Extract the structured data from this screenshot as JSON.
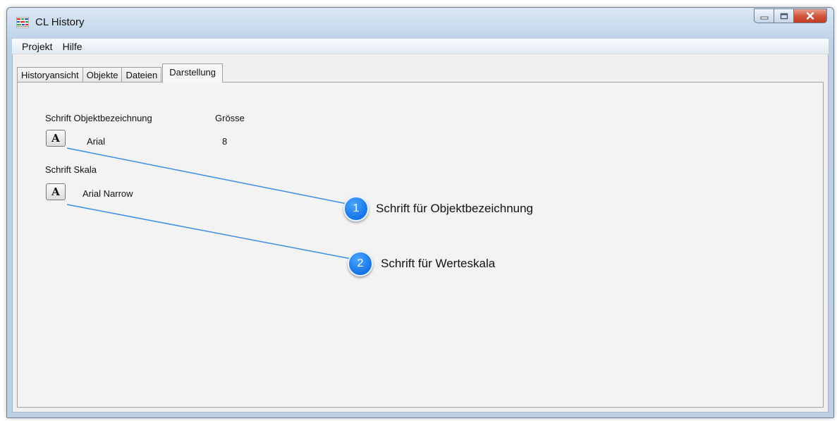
{
  "window": {
    "title": "CL History",
    "icon": "grid-chart-icon"
  },
  "caption_buttons": {
    "minimize": "minimize-icon",
    "maximize": "maximize-icon",
    "close": "close-icon"
  },
  "menu": [
    {
      "label": "Projekt"
    },
    {
      "label": "Hilfe"
    }
  ],
  "tabs": [
    {
      "label": "Historyansicht"
    },
    {
      "label": "Objekte"
    },
    {
      "label": "Dateien"
    },
    {
      "label": "Darstellung",
      "active": true
    }
  ],
  "panel": {
    "object_font_label": "Schrift Objektbezeichnung",
    "size_label": "Grösse",
    "object_font_name": "Arial",
    "object_font_size": "8",
    "scale_font_label": "Schrift Skala",
    "scale_font_name": "Arial Narrow",
    "font_button_glyph": "A"
  },
  "callouts": [
    {
      "number": "1",
      "text": "Schrift für Objektbezeichnung"
    },
    {
      "number": "2",
      "text": "Schrift für Werteskala"
    }
  ],
  "colors": {
    "callout_blue": "#1673e6",
    "leader_line": "#3a8ee6"
  }
}
